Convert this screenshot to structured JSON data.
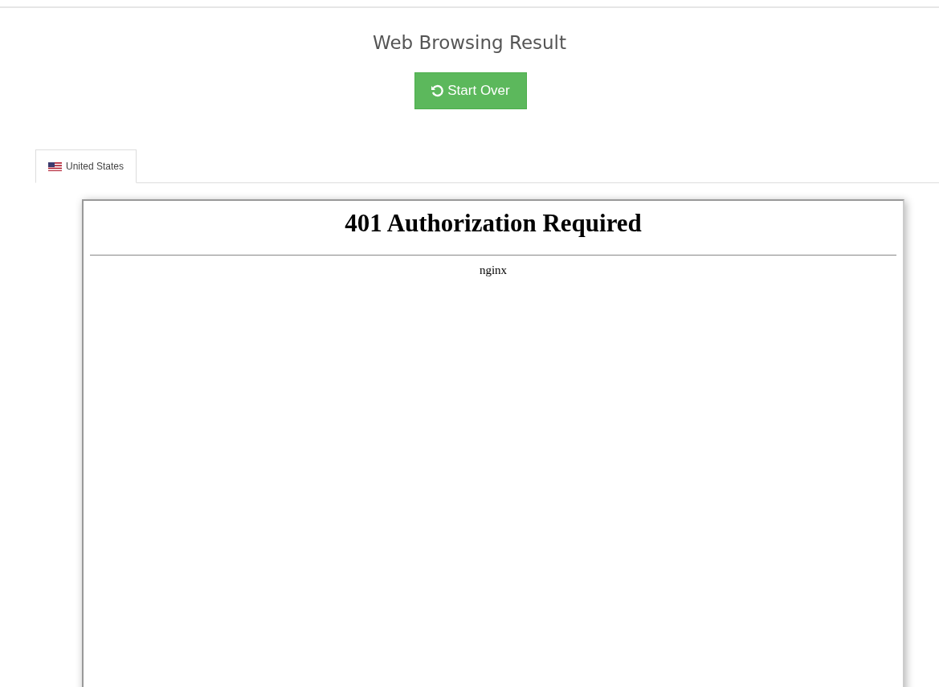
{
  "page": {
    "title": "Web Browsing Result",
    "start_over_button": "Start Over"
  },
  "tabs": [
    {
      "label": "United States",
      "selected": true
    }
  ],
  "frame": {
    "heading": "401 Authorization Required",
    "server": "nginx"
  }
}
